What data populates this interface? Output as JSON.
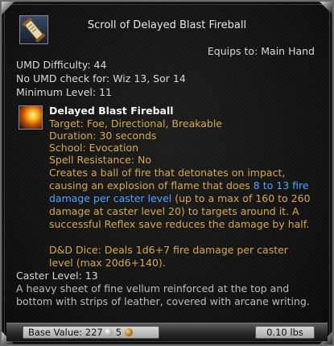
{
  "item": {
    "title": "Scroll of Delayed Blast Fireball",
    "equips": "Equips to: Main Hand",
    "umd_difficulty": "UMD Difficulty: 44",
    "no_umd_check": "No UMD check for: Wiz 13, Sor 14",
    "minimum_level": "Minimum Level: 11",
    "icon": "scroll-icon"
  },
  "spell": {
    "icon": "fireball-icon",
    "name": "Delayed Blast Fireball",
    "target": "Target: Foe, Directional, Breakable",
    "duration": "Duration: 30 seconds",
    "school": "School: Evocation",
    "resistance": "Spell Resistance: No",
    "desc_part1": "Creates a ball of fire that detonates on impact, causing an explosion of flame that does ",
    "desc_highlight": "8 to 13 fire damage per caster level",
    "desc_part2": " (up to a max of 160 to 260 damage at caster level 20) to targets around it. A successful Reflex save reduces the damage by half.",
    "dice": "D&D Dice: Deals 1d6+7 fire damage per caster level (max 20d6+140)."
  },
  "caster_level": "Caster Level: 13",
  "flavor": "A heavy sheet of fine vellum reinforced at the top and bottom with strips of leather, covered with arcane writing.",
  "footer": {
    "base_value_label": "Base Value: 227",
    "silver_icon": "silver-coin-icon",
    "copper_amount": "5",
    "copper_icon": "copper-coin-icon",
    "weight": "0.10 lbs"
  },
  "colors": {
    "spell_text": "#d7a94a",
    "highlight": "#4aa6ff",
    "main_text": "#d8d8d8"
  }
}
